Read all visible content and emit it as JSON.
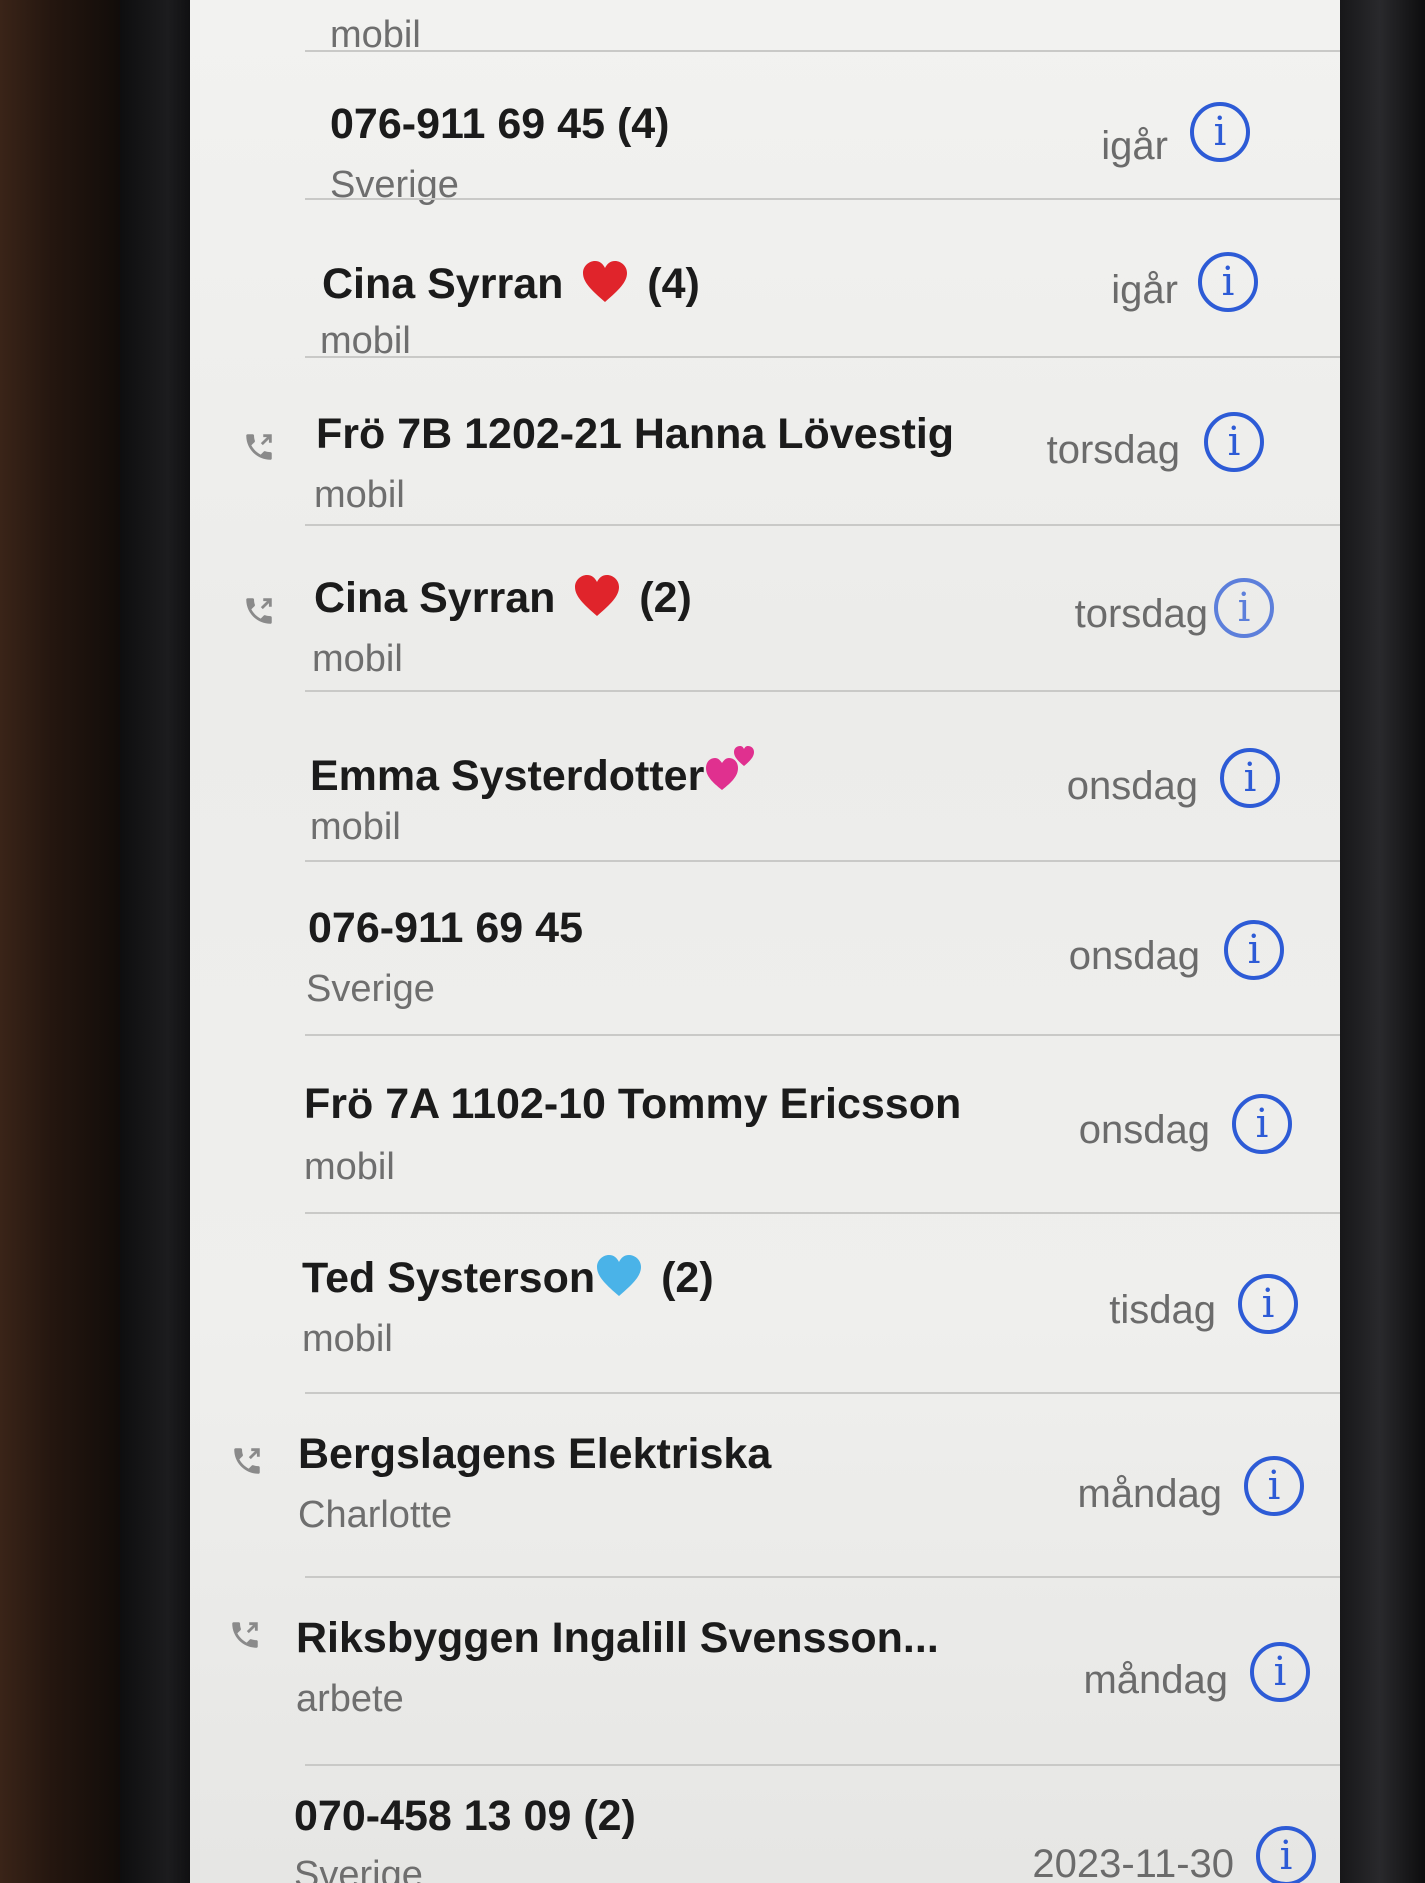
{
  "top_partial": {
    "sub": "mobil"
  },
  "rows": [
    {
      "name": "076-911 69 45",
      "count": "(4)",
      "sub": "Sverige",
      "date": "igår"
    },
    {
      "name": "Cina Syrran",
      "emoji": "red-heart",
      "count": "(4)",
      "sub": "mobil",
      "date": "igår"
    },
    {
      "name": "Frö 7B 1202-21 Hanna Lövestig",
      "count": "",
      "sub": "mobil",
      "date": "torsdag",
      "outgoing": true
    },
    {
      "name": "Cina Syrran",
      "emoji": "red-heart",
      "count": "(2)",
      "sub": "mobil",
      "date": "torsdag",
      "outgoing": true
    },
    {
      "name": "Emma Systerdotter",
      "emoji": "two-pink-hearts",
      "count": "",
      "sub": "mobil",
      "date": "onsdag"
    },
    {
      "name": "076-911 69 45",
      "count": "",
      "sub": "Sverige",
      "date": "onsdag"
    },
    {
      "name": "Frö 7A 1102-10 Tommy Ericsson",
      "count": "",
      "sub": "mobil",
      "date": "onsdag"
    },
    {
      "name": "Ted Systerson",
      "emoji": "light-blue-heart",
      "count": "(2)",
      "sub": "mobil",
      "date": "tisdag"
    },
    {
      "name": "Bergslagens Elektriska",
      "count": "",
      "sub": "Charlotte",
      "date": "måndag",
      "outgoing": true
    },
    {
      "name": "Riksbyggen Ingalill Svensson...",
      "count": "",
      "sub": "arbete",
      "date": "måndag",
      "outgoing": true
    },
    {
      "name": "070-458 13 09",
      "count": "(2)",
      "sub": "Sverige",
      "date": "2023-11-30"
    }
  ],
  "info_glyph": "i",
  "colors": {
    "accent": "#2d5bd6",
    "secondary_text": "#6e6e6e",
    "heart_red": "#e0242b",
    "heart_pink": "#e0308f",
    "heart_blue": "#4ab3e8"
  }
}
